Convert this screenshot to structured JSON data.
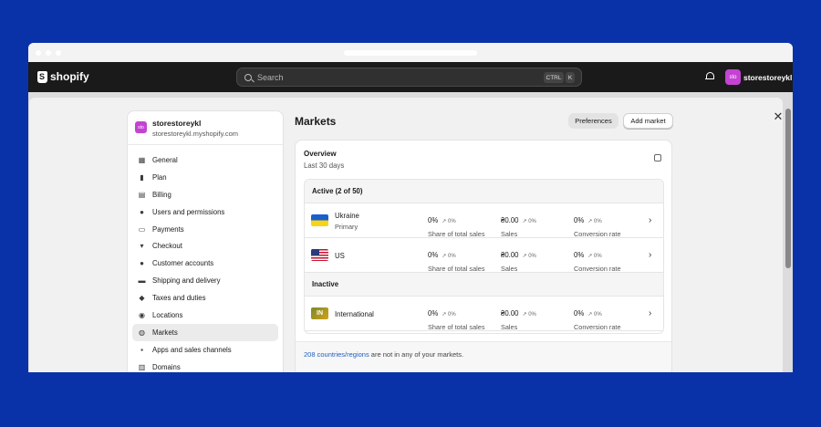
{
  "topbar": {
    "brand": "shopify",
    "search_placeholder": "Search",
    "kbd_ctrl": "CTRL",
    "kbd_k": "K",
    "avatar_initials": "sto",
    "store_name": "storestoreykl"
  },
  "sidebar": {
    "avatar_initials": "sto",
    "store_name": "storestoreykl",
    "store_url": "storestoreykl.myshopify.com",
    "items": [
      {
        "label": "General",
        "icon": "store-icon"
      },
      {
        "label": "Plan",
        "icon": "plan-icon"
      },
      {
        "label": "Billing",
        "icon": "billing-icon"
      },
      {
        "label": "Users and permissions",
        "icon": "users-icon"
      },
      {
        "label": "Payments",
        "icon": "payments-icon"
      },
      {
        "label": "Checkout",
        "icon": "cart-icon"
      },
      {
        "label": "Customer accounts",
        "icon": "customer-icon"
      },
      {
        "label": "Shipping and delivery",
        "icon": "truck-icon"
      },
      {
        "label": "Taxes and duties",
        "icon": "tax-icon"
      },
      {
        "label": "Locations",
        "icon": "location-icon"
      },
      {
        "label": "Markets",
        "icon": "globe-icon",
        "active": true
      },
      {
        "label": "Apps and sales channels",
        "icon": "apps-icon"
      },
      {
        "label": "Domains",
        "icon": "domains-icon"
      }
    ]
  },
  "main": {
    "title": "Markets",
    "preferences_label": "Preferences",
    "add_market_label": "Add market",
    "overview_title": "Overview",
    "overview_period": "Last 30 days",
    "active_group": "Active (2 of 50)",
    "inactive_group": "Inactive",
    "markets": [
      {
        "name": "Ukraine",
        "sub": "Primary",
        "flag": "UA",
        "share": "0%",
        "share_delta": "↗ 0%",
        "share_label": "Share of total sales",
        "sales": "₴0.00",
        "sales_delta": "↗ 0%",
        "sales_label": "Sales",
        "conv": "0%",
        "conv_delta": "↗ 0%",
        "conv_label": "Conversion rate"
      },
      {
        "name": "US",
        "sub": "",
        "flag": "US",
        "share": "0%",
        "share_delta": "↗ 0%",
        "share_label": "Share of total sales",
        "sales": "₴0.00",
        "sales_delta": "↗ 0%",
        "sales_label": "Sales",
        "conv": "0%",
        "conv_delta": "↗ 0%",
        "conv_label": "Conversion rate"
      },
      {
        "name": "International",
        "sub": "",
        "flag": "IN",
        "share": "0%",
        "share_delta": "↗ 0%",
        "share_label": "Share of total sales",
        "sales": "₴0.00",
        "sales_delta": "↗ 0%",
        "sales_label": "Sales",
        "conv": "0%",
        "conv_delta": "↗ 0%",
        "conv_label": "Conversion rate"
      }
    ],
    "footer_link": "208 countries/regions",
    "footer_text": " are not in any of your markets."
  },
  "colors": {
    "frame_bg": "#0a32a8",
    "topbar_bg": "#1a1a1a",
    "avatar": "#c443d3",
    "link": "#1f5fbf"
  }
}
